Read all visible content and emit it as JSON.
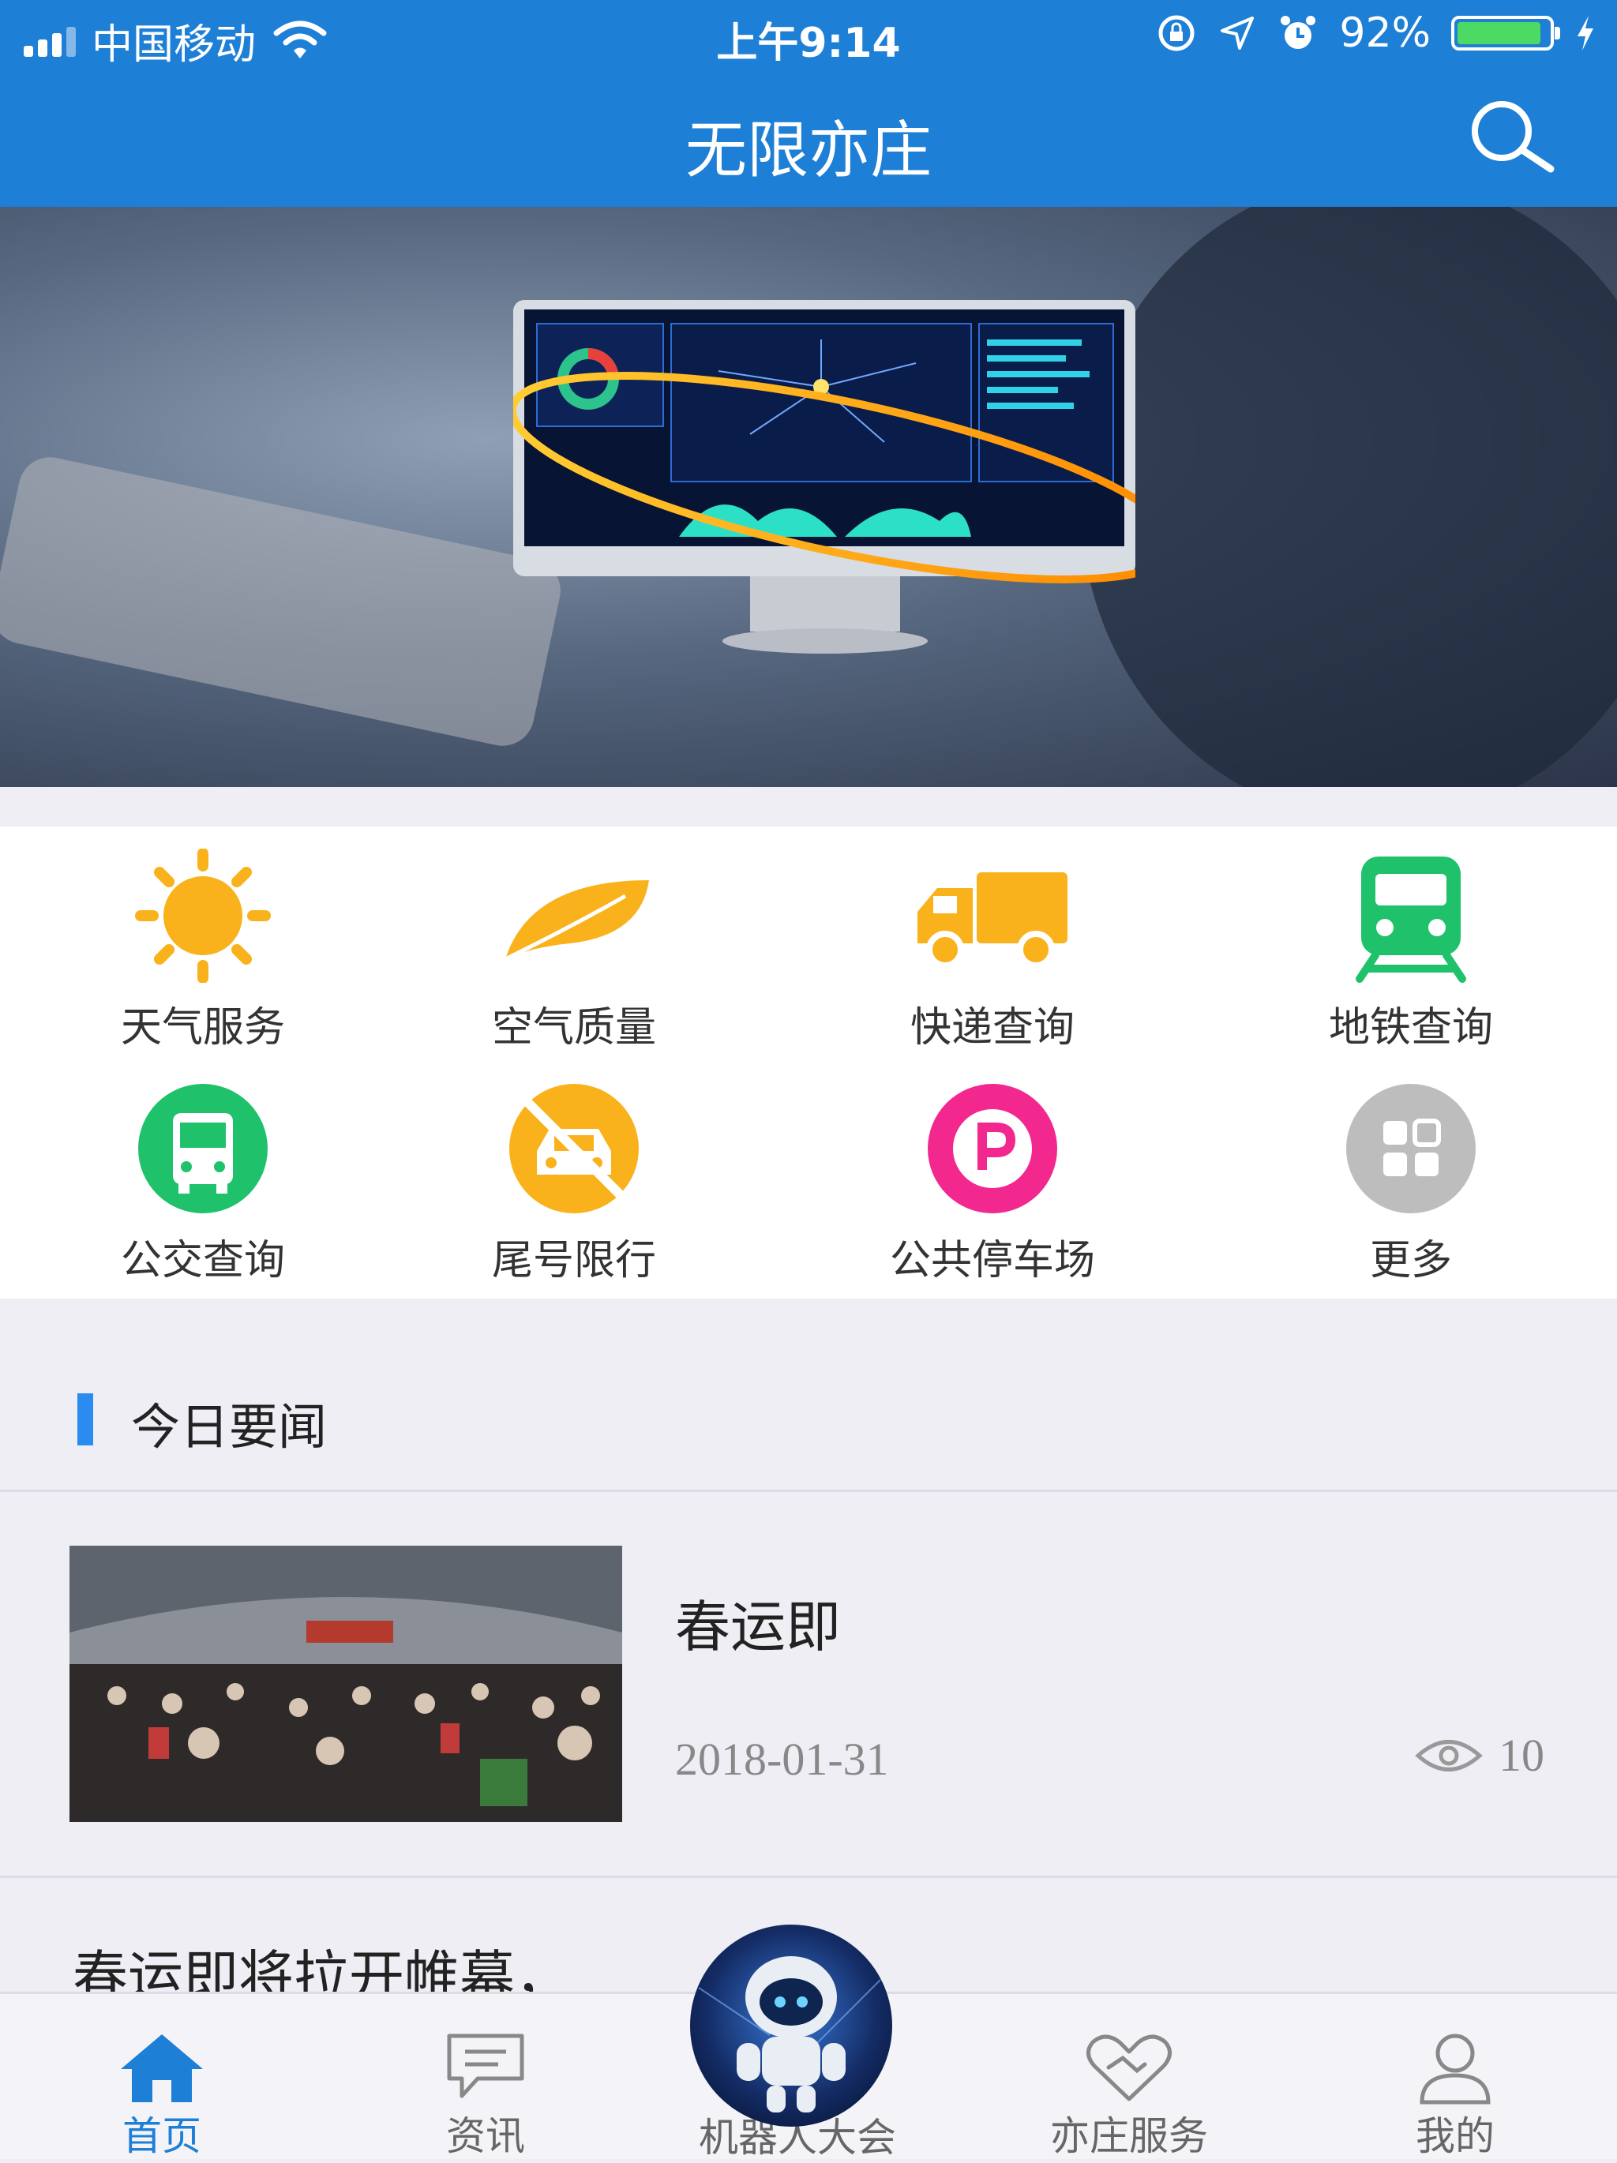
{
  "status_bar": {
    "carrier": "中国移动",
    "time": "上午9:14",
    "battery_percent_text": "92%",
    "battery_level": 0.92
  },
  "header": {
    "title": "无限亦庄"
  },
  "services": [
    {
      "label": "天气服务",
      "icon": "sun-icon",
      "color": "#f9b21b"
    },
    {
      "label": "空气质量",
      "icon": "leaf-icon",
      "color": "#f9b21b"
    },
    {
      "label": "快递查询",
      "icon": "truck-icon",
      "color": "#f9b21b"
    },
    {
      "label": "地铁查询",
      "icon": "subway-icon",
      "color": "#1fc26b"
    },
    {
      "label": "公交查询",
      "icon": "bus-icon",
      "color": "#1fc26b"
    },
    {
      "label": "尾号限行",
      "icon": "no-car-icon",
      "color": "#f9b21b"
    },
    {
      "label": "公共停车场",
      "icon": "parking-icon",
      "color": "#f2288f"
    },
    {
      "label": "更多",
      "icon": "more-grid-icon",
      "color": "#bdbdbd"
    }
  ],
  "news_section": {
    "title": "今日要闻",
    "items": [
      {
        "title": "春运即",
        "date": "2018-01-31",
        "views": "10"
      }
    ],
    "next_preview": "春运即将拉开帷幕，"
  },
  "tabbar": {
    "items": [
      {
        "label": "首页",
        "icon": "home-icon",
        "active": true
      },
      {
        "label": "资讯",
        "icon": "message-icon",
        "active": false
      },
      {
        "label": "机器人大会",
        "icon": "robot-icon",
        "active": false
      },
      {
        "label": "亦庄服务",
        "icon": "handshake-heart-icon",
        "active": false
      },
      {
        "label": "我的",
        "icon": "user-icon",
        "active": false
      }
    ]
  },
  "colors": {
    "brand_blue": "#1e7fd6",
    "accent_bar": "#2a8cf0",
    "active_tab": "#1e7fd6"
  }
}
